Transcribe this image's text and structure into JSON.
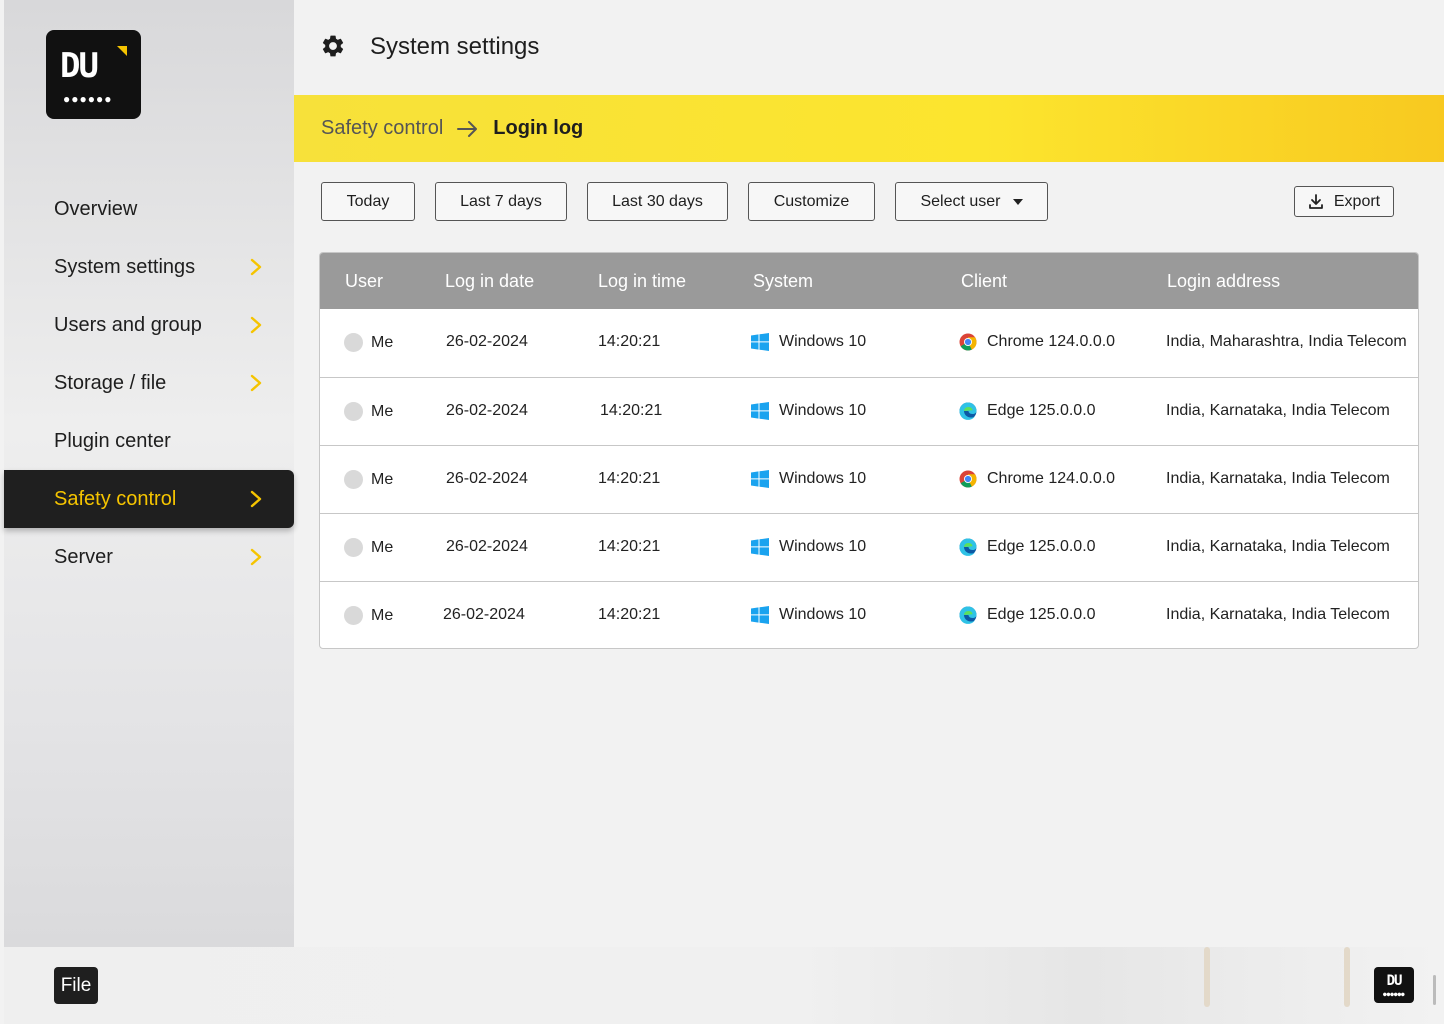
{
  "app": {
    "logo_text": "DU",
    "logo_dots": "●●●●●●"
  },
  "sidebar": {
    "items": [
      {
        "label": "Overview",
        "has_chevron": false,
        "active": false
      },
      {
        "label": "System settings",
        "has_chevron": true,
        "active": false
      },
      {
        "label": "Users and group",
        "has_chevron": true,
        "active": false
      },
      {
        "label": "Storage / file",
        "has_chevron": true,
        "active": false
      },
      {
        "label": "Plugin center",
        "has_chevron": false,
        "active": false
      },
      {
        "label": "Safety control",
        "has_chevron": true,
        "active": true
      },
      {
        "label": "Server",
        "has_chevron": true,
        "active": false
      }
    ]
  },
  "header": {
    "title": "System settings",
    "icon": "gear-icon"
  },
  "breadcrumb": {
    "parent": "Safety control",
    "current": "Login log"
  },
  "filters": {
    "today": "Today",
    "last7": "Last 7 days",
    "last30": "Last 30 days",
    "customize": "Customize",
    "select_user": "Select user",
    "export": "Export"
  },
  "table": {
    "headers": {
      "user": "User",
      "date": "Log in date",
      "time": "Log in time",
      "system": "System",
      "client": "Client",
      "address": "Login address"
    },
    "rows": [
      {
        "user": "Me",
        "date": "26-02-2024",
        "time": "14:20:21",
        "system": "Windows 10",
        "client": "Chrome 124.0.0.0",
        "browser": "chrome",
        "address": "India, Maharashtra, India Telecom"
      },
      {
        "user": "Me",
        "date": "26-02-2024",
        "time": "14:20:21",
        "system": "Windows 10",
        "client": "Edge 125.0.0.0",
        "browser": "edge",
        "address": "India, Karnataka, India Telecom"
      },
      {
        "user": "Me",
        "date": "26-02-2024",
        "time": "14:20:21",
        "system": "Windows 10",
        "client": "Chrome 124.0.0.0",
        "browser": "chrome",
        "address": "India, Karnataka, India Telecom"
      },
      {
        "user": "Me",
        "date": "26-02-2024",
        "time": "14:20:21",
        "system": "Windows 10",
        "client": "Edge 125.0.0.0",
        "browser": "edge",
        "address": "India, Karnataka, India Telecom"
      },
      {
        "user": "Me",
        "date": "26-02-2024",
        "time": "14:20:21",
        "system": "Windows 10",
        "client": "Edge 125.0.0.0",
        "browser": "edge",
        "address": "India, Karnataka, India Telecom"
      }
    ]
  },
  "footer": {
    "file_label": "File"
  },
  "colors": {
    "accent": "#f5c400",
    "active_bg": "#1f1f1f",
    "table_header": "#9a9a9a"
  }
}
